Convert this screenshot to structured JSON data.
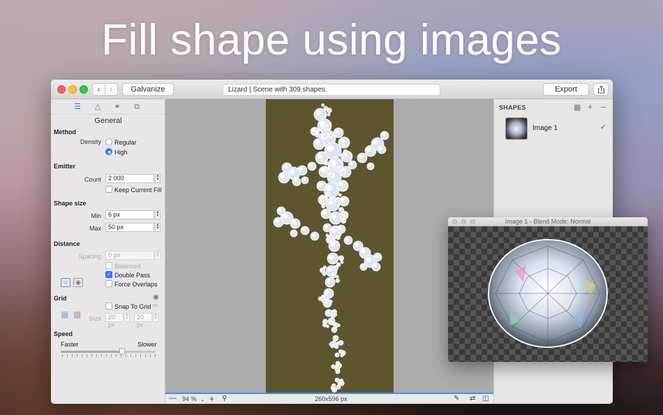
{
  "headline": "Fill shape using images",
  "toolbar": {
    "galvanize_label": "Galvanize",
    "status": "Lizard | Scene with 309 shapes.",
    "export_label": "Export"
  },
  "sidebar": {
    "panel_title": "General",
    "method": {
      "heading": "Method",
      "density_label": "Density",
      "options": [
        "Regular",
        "High"
      ],
      "selected": "High"
    },
    "emitter": {
      "heading": "Emitter",
      "count_label": "Count",
      "count_value": "2 000",
      "keep_fill_label": "Keep Current Fill"
    },
    "shape_size": {
      "heading": "Shape size",
      "min_label": "Min",
      "min_value": "6 px",
      "max_label": "Max",
      "max_value": "50 px"
    },
    "distance": {
      "heading": "Distance",
      "spacing_label": "Spacing",
      "spacing_placeholder": "0 px",
      "balanced_label": "Balanced",
      "double_pass_label": "Double Pass",
      "force_overlaps_label": "Force Overlaps"
    },
    "grid": {
      "heading": "Grid",
      "snap_label": "Snap To Grid",
      "size_label": "Size",
      "size_x": "20 px",
      "size_y": "20 px"
    },
    "speed": {
      "heading": "Speed",
      "faster_label": "Faster",
      "slower_label": "Slower",
      "level_fraction": 0.65
    }
  },
  "bottombar": {
    "zoom": "94 %",
    "canvas_size": "260x596 px"
  },
  "shapes_panel": {
    "title": "SHAPES",
    "items": [
      {
        "name": "Image 1",
        "checked": true
      }
    ]
  },
  "preview": {
    "title": "Image 1 - Blend Mode: Normal"
  },
  "colors": {
    "accent": "#2f7bea",
    "canvas_background": "#5d552e"
  }
}
